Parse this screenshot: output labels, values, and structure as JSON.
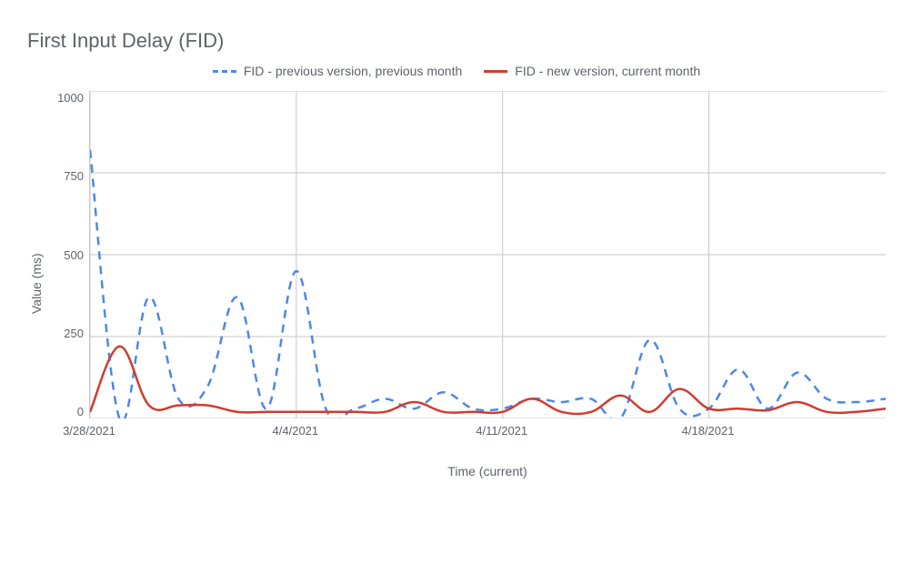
{
  "chart_data": {
    "type": "line",
    "title": "First Input Delay (FID)",
    "xlabel": "Time (current)",
    "ylabel": "Value (ms)",
    "ylim": [
      0,
      1000
    ],
    "x_tick_labels": [
      "3/28/2021",
      "4/4/2021",
      "4/11/2021",
      "4/18/2021"
    ],
    "x": [
      "3/28/2021",
      "3/29/2021",
      "3/30/2021",
      "3/31/2021",
      "4/1/2021",
      "4/2/2021",
      "4/3/2021",
      "4/4/2021",
      "4/5/2021",
      "4/6/2021",
      "4/7/2021",
      "4/8/2021",
      "4/9/2021",
      "4/10/2021",
      "4/11/2021",
      "4/12/2021",
      "4/13/2021",
      "4/14/2021",
      "4/15/2021",
      "4/16/2021",
      "4/17/2021",
      "4/18/2021",
      "4/19/2021",
      "4/20/2021",
      "4/21/2021",
      "4/22/2021",
      "4/23/2021",
      "4/24/2021"
    ],
    "series": [
      {
        "name": "FID - previous version, previous month",
        "style": "dashed",
        "color": "#4e87ea",
        "values": [
          820,
          0,
          370,
          60,
          100,
          370,
          30,
          450,
          30,
          30,
          60,
          30,
          80,
          30,
          30,
          60,
          50,
          60,
          0,
          240,
          30,
          30,
          150,
          30,
          140,
          60,
          50,
          60
        ]
      },
      {
        "name": "FID - new version, current month",
        "style": "solid",
        "color": "#d23b2f",
        "values": [
          20,
          220,
          40,
          40,
          40,
          20,
          20,
          20,
          20,
          20,
          20,
          50,
          20,
          20,
          20,
          60,
          20,
          20,
          70,
          20,
          90,
          30,
          30,
          25,
          50,
          20,
          20,
          30
        ]
      }
    ]
  },
  "y_ticks": [
    "1000",
    "750",
    "500",
    "250",
    "0"
  ]
}
